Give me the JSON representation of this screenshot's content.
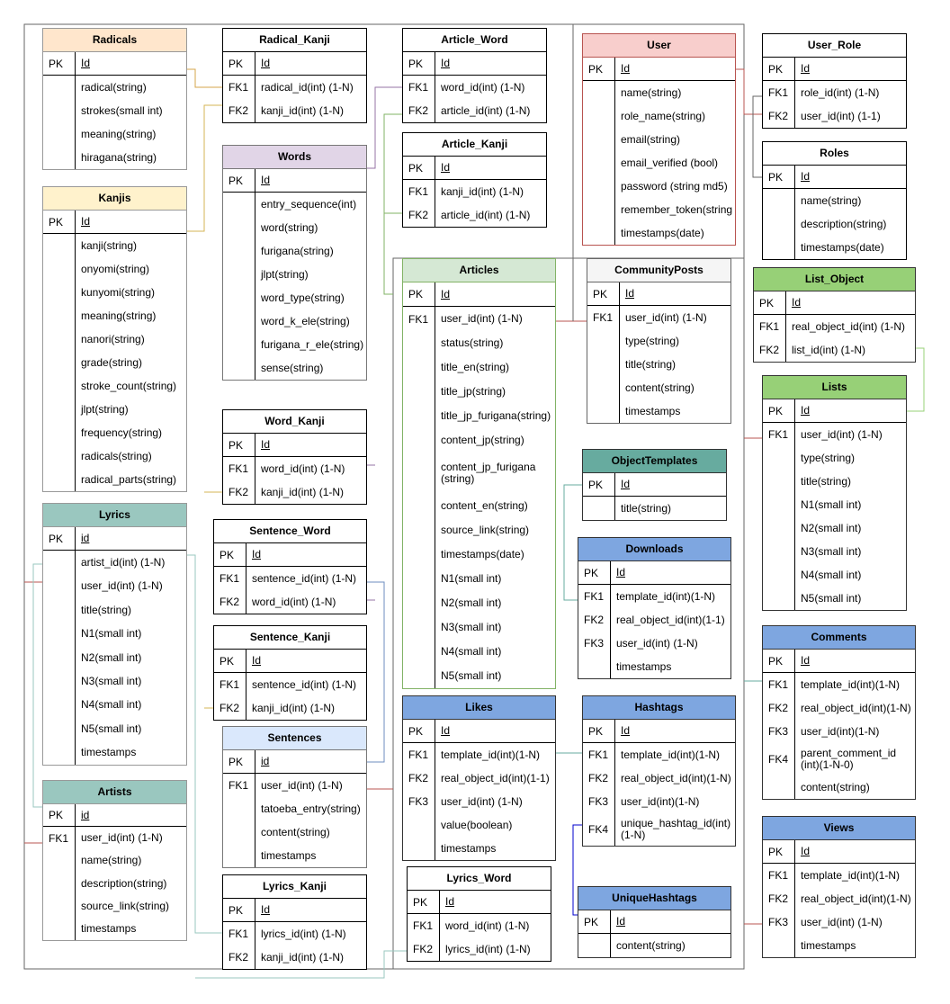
{
  "tables": [
    {
      "name": "Radicals",
      "color": "#FFE6CC",
      "border": "#999",
      "rows": [
        {
          "key": "PK",
          "field": "Id"
        },
        {
          "key": "",
          "field": "radical(string)"
        },
        {
          "key": "",
          "field": "strokes(small int)"
        },
        {
          "key": "",
          "field": "meaning(string)"
        },
        {
          "key": "",
          "field": "hiragana(string)"
        }
      ]
    },
    {
      "name": "Kanjis",
      "color": "#FFF2CC",
      "border": "#999",
      "rows": [
        {
          "key": "PK",
          "field": "Id"
        },
        {
          "key": "",
          "field": "kanji(string)"
        },
        {
          "key": "",
          "field": "onyomi(string)"
        },
        {
          "key": "",
          "field": "kunyomi(string)"
        },
        {
          "key": "",
          "field": "meaning(string)"
        },
        {
          "key": "",
          "field": "nanori(string)"
        },
        {
          "key": "",
          "field": "grade(string)"
        },
        {
          "key": "",
          "field": "stroke_count(string)"
        },
        {
          "key": "",
          "field": "jlpt(string)"
        },
        {
          "key": "",
          "field": "frequency(string)"
        },
        {
          "key": "",
          "field": "radicals(string)"
        },
        {
          "key": "",
          "field": "radical_parts(string)"
        }
      ]
    },
    {
      "name": "Lyrics",
      "color": "#9AC7BF",
      "border": "#999",
      "rows": [
        {
          "key": "PK",
          "field": "id"
        },
        {
          "key": "",
          "field": "artist_id(int) (1-N)"
        },
        {
          "key": "",
          "field": "user_id(int) (1-N)"
        },
        {
          "key": "",
          "field": "title(string)"
        },
        {
          "key": "",
          "field": "N1(small int)"
        },
        {
          "key": "",
          "field": "N2(small int)"
        },
        {
          "key": "",
          "field": "N3(small int)"
        },
        {
          "key": "",
          "field": "N4(small int)"
        },
        {
          "key": "",
          "field": "N5(small int)"
        },
        {
          "key": "",
          "field": "timestamps"
        }
      ]
    },
    {
      "name": "Artists",
      "color": "#9AC7BF",
      "border": "#999",
      "rows": [
        {
          "key": "PK",
          "field": "id"
        },
        {
          "key": "FK1",
          "field": "user_id(int) (1-N)"
        },
        {
          "key": "",
          "field": "name(string)"
        },
        {
          "key": "",
          "field": "description(string)"
        },
        {
          "key": "",
          "field": "source_link(string)"
        },
        {
          "key": "",
          "field": "timestamps"
        }
      ]
    },
    {
      "name": "Radical_Kanji",
      "color": "#FFFFFF",
      "border": "#000",
      "rows": [
        {
          "key": "PK",
          "field": "Id"
        },
        {
          "key": "FK1",
          "field": "radical_id(int) (1-N)"
        },
        {
          "key": "FK2",
          "field": "kanji_id(int) (1-N)"
        }
      ]
    },
    {
      "name": "Words",
      "color": "#E1D5E7",
      "border": "#777",
      "rows": [
        {
          "key": "PK",
          "field": "Id"
        },
        {
          "key": "",
          "field": "entry_sequence(int)"
        },
        {
          "key": "",
          "field": "word(string)"
        },
        {
          "key": "",
          "field": "furigana(string)"
        },
        {
          "key": "",
          "field": "jlpt(string)"
        },
        {
          "key": "",
          "field": "word_type(string)"
        },
        {
          "key": "",
          "field": "word_k_ele(string)"
        },
        {
          "key": "",
          "field": "furigana_r_ele(string)"
        },
        {
          "key": "",
          "field": "sense(string)"
        }
      ]
    },
    {
      "name": "Word_Kanji",
      "color": "#FFFFFF",
      "border": "#000",
      "rows": [
        {
          "key": "PK",
          "field": "Id"
        },
        {
          "key": "FK1",
          "field": "word_id(int) (1-N)"
        },
        {
          "key": "FK2",
          "field": "kanji_id(int) (1-N)"
        }
      ]
    },
    {
      "name": "Sentence_Word",
      "color": "#FFFFFF",
      "border": "#000",
      "rows": [
        {
          "key": "PK",
          "field": "Id"
        },
        {
          "key": "FK1",
          "field": "sentence_id(int) (1-N)"
        },
        {
          "key": "FK2",
          "field": "word_id(int) (1-N)"
        }
      ]
    },
    {
      "name": "Sentence_Kanji",
      "color": "#FFFFFF",
      "border": "#000",
      "rows": [
        {
          "key": "PK",
          "field": "Id"
        },
        {
          "key": "FK1",
          "field": "sentence_id(int) (1-N)"
        },
        {
          "key": "FK2",
          "field": "kanji_id(int) (1-N)"
        }
      ]
    },
    {
      "name": "Sentences",
      "color": "#DAE8FC",
      "border": "#777",
      "rows": [
        {
          "key": "PK",
          "field": "id"
        },
        {
          "key": "FK1",
          "field": "user_id(int) (1-N)"
        },
        {
          "key": "",
          "field": "tatoeba_entry(string)"
        },
        {
          "key": "",
          "field": "content(string)"
        },
        {
          "key": "",
          "field": "timestamps"
        }
      ]
    },
    {
      "name": "Lyrics_Kanji",
      "color": "#FFFFFF",
      "border": "#000",
      "rows": [
        {
          "key": "PK",
          "field": "Id"
        },
        {
          "key": "FK1",
          "field": "lyrics_id(int) (1-N)"
        },
        {
          "key": "FK2",
          "field": "kanji_id(int) (1-N)"
        }
      ]
    },
    {
      "name": "Article_Word",
      "color": "#FFFFFF",
      "border": "#000",
      "rows": [
        {
          "key": "PK",
          "field": "Id"
        },
        {
          "key": "FK1",
          "field": "word_id(int) (1-N)"
        },
        {
          "key": "FK2",
          "field": "article_id(int) (1-N)"
        }
      ]
    },
    {
      "name": "Article_Kanji",
      "color": "#FFFFFF",
      "border": "#000",
      "rows": [
        {
          "key": "PK",
          "field": "Id"
        },
        {
          "key": "FK1",
          "field": "kanji_id(int) (1-N)"
        },
        {
          "key": "FK2",
          "field": "article_id(int) (1-N)"
        }
      ]
    },
    {
      "name": "Articles",
      "color": "#D5E8D4",
      "border": "#82B366",
      "rows": [
        {
          "key": "PK",
          "field": "Id"
        },
        {
          "key": "FK1",
          "field": "user_id(int) (1-N)"
        },
        {
          "key": "",
          "field": "status(string)"
        },
        {
          "key": "",
          "field": "title_en(string)"
        },
        {
          "key": "",
          "field": "title_jp(string)"
        },
        {
          "key": "",
          "field": "title_jp_furigana(string)"
        },
        {
          "key": "",
          "field": "content_jp(string)"
        },
        {
          "key": "",
          "field": "content_jp_furigana (string)"
        },
        {
          "key": "",
          "field": "content_en(string)"
        },
        {
          "key": "",
          "field": "source_link(string)"
        },
        {
          "key": "",
          "field": "timestamps(date)"
        },
        {
          "key": "",
          "field": "N1(small int)"
        },
        {
          "key": "",
          "field": "N2(small int)"
        },
        {
          "key": "",
          "field": "N3(small int)"
        },
        {
          "key": "",
          "field": "N4(small int)"
        },
        {
          "key": "",
          "field": "N5(small int)"
        }
      ]
    },
    {
      "name": "Likes",
      "color": "#7EA6E0",
      "border": "#333",
      "rows": [
        {
          "key": "PK",
          "field": "Id"
        },
        {
          "key": "FK1",
          "field": "template_id(int)(1-N)"
        },
        {
          "key": "FK2",
          "field": "real_object_id(int)(1-1)"
        },
        {
          "key": "FK3",
          "field": "user_id(int) (1-N)"
        },
        {
          "key": "",
          "field": "value(boolean)"
        },
        {
          "key": "",
          "field": "timestamps"
        }
      ]
    },
    {
      "name": "Lyrics_Word",
      "color": "#FFFFFF",
      "border": "#000",
      "rows": [
        {
          "key": "PK",
          "field": "Id"
        },
        {
          "key": "FK1",
          "field": "word_id(int) (1-N)"
        },
        {
          "key": "FK2",
          "field": "lyrics_id(int) (1-N)"
        }
      ]
    },
    {
      "name": "User",
      "color": "#F8CECC",
      "border": "#B85450",
      "rows": [
        {
          "key": "PK",
          "field": "Id"
        },
        {
          "key": "",
          "field": "name(string)"
        },
        {
          "key": "",
          "field": "role_name(string)"
        },
        {
          "key": "",
          "field": "email(string)"
        },
        {
          "key": "",
          "field": "email_verified (bool)"
        },
        {
          "key": "",
          "field": "password (string md5)"
        },
        {
          "key": "",
          "field": "remember_token(string"
        },
        {
          "key": "",
          "field": "timestamps(date)"
        }
      ]
    },
    {
      "name": "CommunityPosts",
      "color": "#F5F5F5",
      "border": "#666",
      "rows": [
        {
          "key": "PK",
          "field": "Id"
        },
        {
          "key": "FK1",
          "field": "user_id(int) (1-N)"
        },
        {
          "key": "",
          "field": "type(string)"
        },
        {
          "key": "",
          "field": "title(string)"
        },
        {
          "key": "",
          "field": "content(string)"
        },
        {
          "key": "",
          "field": "timestamps"
        }
      ]
    },
    {
      "name": "ObjectTemplates",
      "color": "#67AB9F",
      "border": "#333",
      "rows": [
        {
          "key": "PK",
          "field": "Id"
        },
        {
          "key": "",
          "field": "title(string)"
        }
      ]
    },
    {
      "name": "Downloads",
      "color": "#7EA6E0",
      "border": "#333",
      "rows": [
        {
          "key": "PK",
          "field": "Id"
        },
        {
          "key": "FK1",
          "field": "template_id(int)(1-N)"
        },
        {
          "key": "FK2",
          "field": "real_object_id(int)(1-1)"
        },
        {
          "key": "FK3",
          "field": "user_id(int) (1-N)"
        },
        {
          "key": "",
          "field": "timestamps"
        }
      ]
    },
    {
      "name": "Hashtags",
      "color": "#7EA6E0",
      "border": "#333",
      "rows": [
        {
          "key": "PK",
          "field": "Id"
        },
        {
          "key": "FK1",
          "field": "template_id(int)(1-N)"
        },
        {
          "key": "FK2",
          "field": "real_object_id(int)(1-N)"
        },
        {
          "key": "FK3",
          "field": "user_id(int)(1-N)"
        },
        {
          "key": "FK4",
          "field": "unique_hashtag_id(int) (1-N)"
        }
      ]
    },
    {
      "name": "UniqueHashtags",
      "color": "#7EA6E0",
      "border": "#333",
      "rows": [
        {
          "key": "PK",
          "field": "Id"
        },
        {
          "key": "",
          "field": "content(string)"
        }
      ]
    },
    {
      "name": "User_Role",
      "color": "#FFFFFF",
      "border": "#000",
      "rows": [
        {
          "key": "PK",
          "field": "Id"
        },
        {
          "key": "FK1",
          "field": "role_id(int) (1-N)"
        },
        {
          "key": "FK2",
          "field": "user_id(int) (1-1)"
        }
      ]
    },
    {
      "name": "Roles",
      "color": "#FFFFFF",
      "border": "#000",
      "rows": [
        {
          "key": "PK",
          "field": "Id"
        },
        {
          "key": "",
          "field": "name(string)"
        },
        {
          "key": "",
          "field": "description(string)"
        },
        {
          "key": "",
          "field": "timestamps(date)"
        }
      ]
    },
    {
      "name": "List_Object",
      "color": "#97D077",
      "border": "#333",
      "rows": [
        {
          "key": "PK",
          "field": "Id"
        },
        {
          "key": "FK1",
          "field": "real_object_id(int) (1-N)"
        },
        {
          "key": "FK2",
          "field": "list_id(int) (1-N)"
        }
      ]
    },
    {
      "name": "Lists",
      "color": "#97D077",
      "border": "#333",
      "rows": [
        {
          "key": "PK",
          "field": "Id"
        },
        {
          "key": "FK1",
          "field": "user_id(int) (1-N)"
        },
        {
          "key": "",
          "field": "type(string)"
        },
        {
          "key": "",
          "field": "title(string)"
        },
        {
          "key": "",
          "field": "N1(small int)"
        },
        {
          "key": "",
          "field": "N2(small int)"
        },
        {
          "key": "",
          "field": "N3(small int)"
        },
        {
          "key": "",
          "field": "N4(small int)"
        },
        {
          "key": "",
          "field": "N5(small int)"
        }
      ]
    },
    {
      "name": "Comments",
      "color": "#7EA6E0",
      "border": "#333",
      "rows": [
        {
          "key": "PK",
          "field": "Id"
        },
        {
          "key": "FK1",
          "field": "template_id(int)(1-N)"
        },
        {
          "key": "FK2",
          "field": "real_object_id(int)(1-N)"
        },
        {
          "key": "FK3",
          "field": "user_id(int)(1-N)"
        },
        {
          "key": "FK4",
          "field": "parent_comment_id (int)(1-N-0)"
        },
        {
          "key": "",
          "field": "content(string)"
        }
      ]
    },
    {
      "name": "Views",
      "color": "#7EA6E0",
      "border": "#333",
      "rows": [
        {
          "key": "PK",
          "field": "Id"
        },
        {
          "key": "FK1",
          "field": "template_id(int)(1-N)"
        },
        {
          "key": "FK2",
          "field": "real_object_id(int)(1-N)"
        },
        {
          "key": "FK3",
          "field": "user_id(int) (1-N)"
        },
        {
          "key": "",
          "field": "timestamps"
        }
      ]
    }
  ]
}
